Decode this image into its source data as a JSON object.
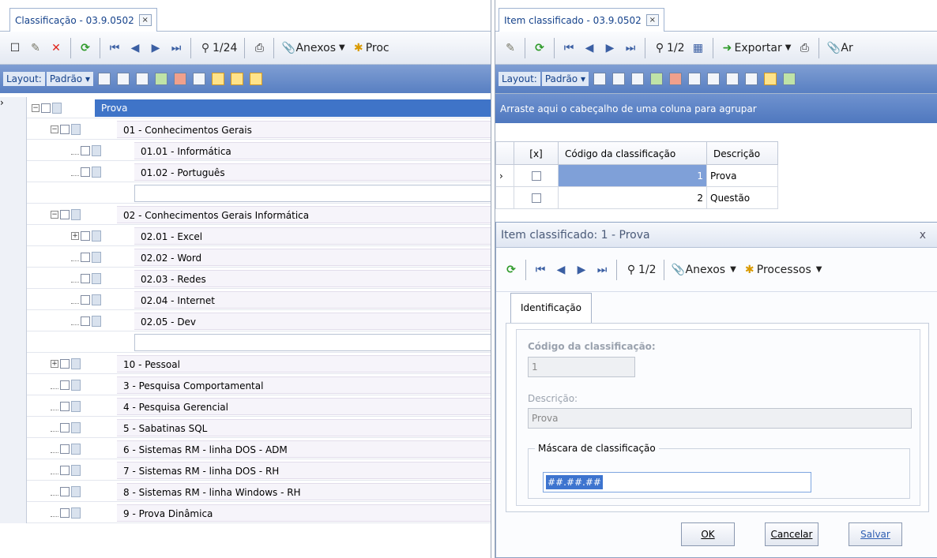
{
  "left": {
    "tab_title": "Classificação - 03.9.0502",
    "tab_close": "×",
    "toolbar": {
      "nav_pos": "1/24",
      "anexos": "Anexos",
      "processos": "Proc"
    },
    "layout": {
      "label": "Layout:",
      "preset": "Padrão"
    },
    "tree": [
      {
        "label": "Prova",
        "level": 0
      },
      {
        "label": "01 - Conhecimentos Gerais",
        "level": 1
      },
      {
        "label": "01.01 - Informática",
        "level": 2
      },
      {
        "label": "01.02 - Português",
        "level": 2
      },
      {
        "label": "",
        "level": 2
      },
      {
        "label": "02 - Conhecimentos Gerais Informática",
        "level": 1
      },
      {
        "label": "02.01 - Excel",
        "level": 2
      },
      {
        "label": "02.02 - Word",
        "level": 2
      },
      {
        "label": "02.03 - Redes",
        "level": 2
      },
      {
        "label": "02.04 - Internet",
        "level": 2
      },
      {
        "label": "02.05 - Dev",
        "level": 2
      },
      {
        "label": "",
        "level": 2
      },
      {
        "label": "10 - Pessoal",
        "level": 1
      },
      {
        "label": "3 - Pesquisa Comportamental",
        "level": 1
      },
      {
        "label": "4 - Pesquisa Gerencial",
        "level": 1
      },
      {
        "label": "5 - Sabatinas SQL",
        "level": 1
      },
      {
        "label": "6 - Sistemas RM - linha DOS - ADM",
        "level": 1
      },
      {
        "label": "7 - Sistemas RM - linha DOS - RH",
        "level": 1
      },
      {
        "label": "8 - Sistemas RM - linha Windows - RH",
        "level": 1
      },
      {
        "label": "9 - Prova Dinâmica",
        "level": 1
      }
    ]
  },
  "right": {
    "tab_title": "Item classificado - 03.9.0502",
    "tab_close": "×",
    "toolbar": {
      "nav_pos": "1/2",
      "exportar": "Exportar",
      "anexos": "Ar"
    },
    "layout": {
      "label": "Layout:",
      "preset": "Padrão"
    },
    "group_hint": "Arraste aqui o cabeçalho de uma coluna para agrupar",
    "grid": {
      "headers": [
        "[x]",
        "Código da classificação",
        "Descrição"
      ],
      "rows": [
        {
          "codigo": "1",
          "descricao": "Prova"
        },
        {
          "codigo": "2",
          "descricao": "Questão"
        }
      ]
    },
    "dialog": {
      "title": "Item classificado: 1 - Prova",
      "close": "x",
      "toolbar": {
        "nav_pos": "1/2",
        "anexos": "Anexos",
        "processos": "Processos"
      },
      "tab": "Identificação",
      "codigo_label": "Código da classificação:",
      "codigo_value": "1",
      "descricao_label": "Descrição:",
      "descricao_value": "Prova",
      "mascara_legend": "Máscara de classificação",
      "mascara_value": "##.##.##",
      "buttons": {
        "ok": "OK",
        "cancelar": "Cancelar",
        "salvar": "Salvar"
      }
    }
  }
}
